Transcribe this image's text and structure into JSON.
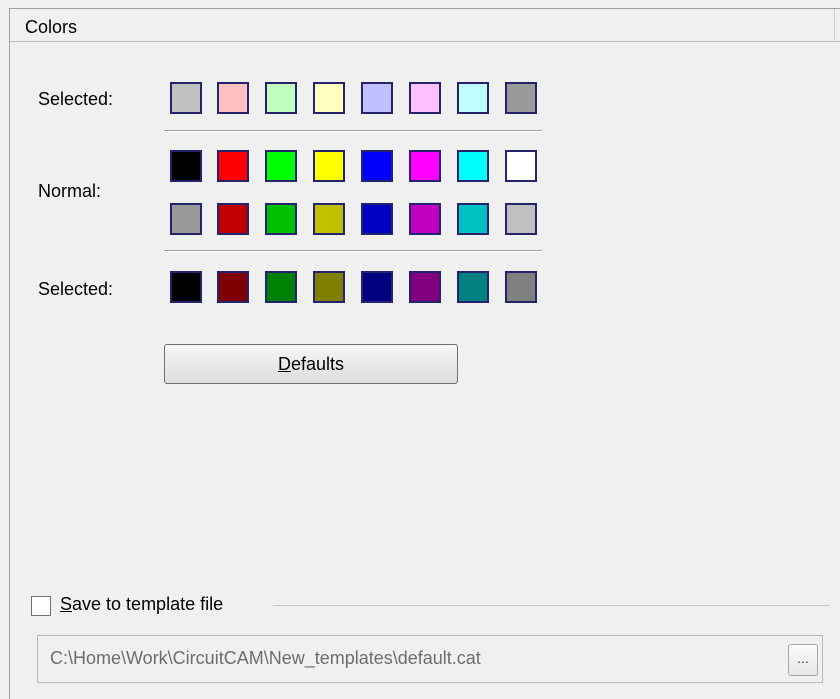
{
  "header": {
    "title": "Colors"
  },
  "labels": {
    "selected_top": "Selected:",
    "normal": "Normal:",
    "selected_bottom": "Selected:"
  },
  "swatches": {
    "selected_top": [
      "#c0c0c0",
      "#ffc0c0",
      "#c0ffc0",
      "#ffffc0",
      "#c0c0ff",
      "#ffc0ff",
      "#c0ffff",
      "#999999"
    ],
    "normal_1": [
      "#000000",
      "#ff0000",
      "#00ff00",
      "#ffff00",
      "#0000ff",
      "#ff00ff",
      "#00ffff",
      "#ffffff"
    ],
    "normal_2": [
      "#9a9a9a",
      "#c00000",
      "#00c000",
      "#c0c000",
      "#0000c0",
      "#c000c0",
      "#00c0c0",
      "#c0c0c0"
    ],
    "selected_bottom": [
      "#000000",
      "#800000",
      "#008000",
      "#808000",
      "#000080",
      "#800080",
      "#008080",
      "#808080"
    ]
  },
  "defaults_button": {
    "underlined": "D",
    "rest": "efaults"
  },
  "save_template": {
    "checked": false,
    "underlined": "S",
    "rest": "ave to template file"
  },
  "template_path": "C:\\Home\\Work\\CircuitCAM\\New_templates\\default.cat",
  "browse_button": {
    "label": "..."
  }
}
